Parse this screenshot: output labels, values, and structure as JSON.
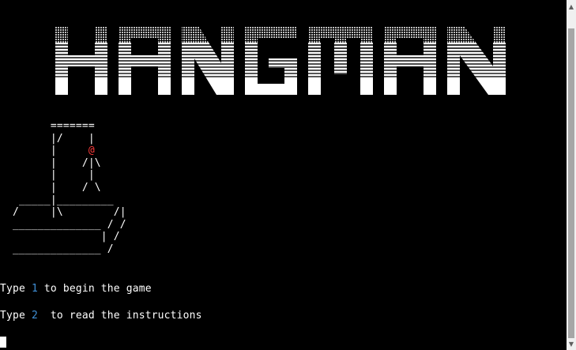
{
  "title": "HANGMAN",
  "gallows_art": "        =======\n        |/    |\n        |     @\n        |    /|\\\n        |     |\n        |    / \\\n   _____|_________\n  /     |\\        /|\n  ______________ / /\n                | /\n  ______________ /",
  "prompts": [
    {
      "prefix": "Type ",
      "number": "1",
      "suffix": " to begin the game"
    },
    {
      "prefix": "Type ",
      "number": "2",
      "suffix": "  to read the instructions"
    }
  ],
  "colors": {
    "background": "#000000",
    "text": "#ffffff",
    "number_accent": "#3f8fd6",
    "hanged_head": "#ff3b3b"
  },
  "icons": {
    "scroll_up": "triangle-up-icon",
    "scroll_down": "triangle-down-icon"
  }
}
